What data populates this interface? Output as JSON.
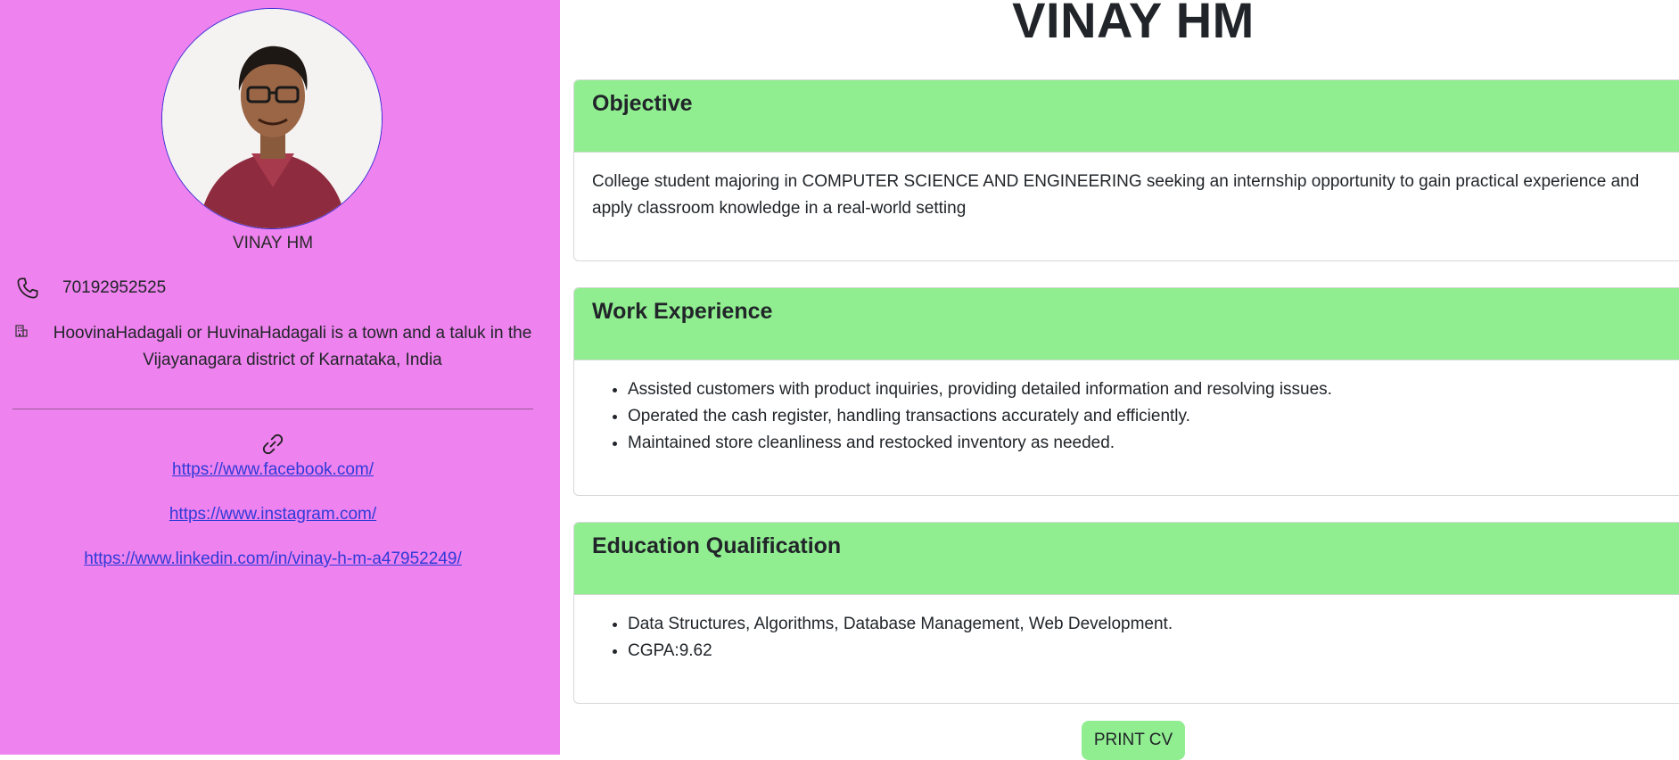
{
  "sidebar": {
    "name": "VINAY HM",
    "phone": "70192952525",
    "address": "HoovinaHadagali or HuvinaHadagali is a town and a taluk in the Vijayanagara district of Karnataka, India",
    "links": [
      "https://www.facebook.com/",
      "https://www.instagram.com/",
      "https://www.linkedin.com/in/vinay-h-m-a47952249/"
    ],
    "icons": {
      "phone": "phone-icon",
      "address": "building-icon",
      "links": "link-icon"
    },
    "background_color": "#ee82ee"
  },
  "main": {
    "title": "VINAY HM",
    "objective": {
      "heading": "Objective",
      "text": "College student majoring in COMPUTER SCIENCE AND ENGINEERING seeking an internship opportunity to gain practical experience and apply classroom knowledge in a real-world setting"
    },
    "work_experience": {
      "heading": "Work Experience",
      "items": [
        "Assisted customers with product inquiries, providing detailed information and resolving issues.",
        "Operated the cash register, handling transactions accurately and efficiently.",
        "Maintained store cleanliness and restocked inventory as needed."
      ]
    },
    "education": {
      "heading": "Education Qualification",
      "items": [
        "Data Structures, Algorithms, Database Management, Web Development.",
        "CGPA:9.62"
      ]
    },
    "print_button": "PRINT CV",
    "header_color": "#90ee90"
  }
}
